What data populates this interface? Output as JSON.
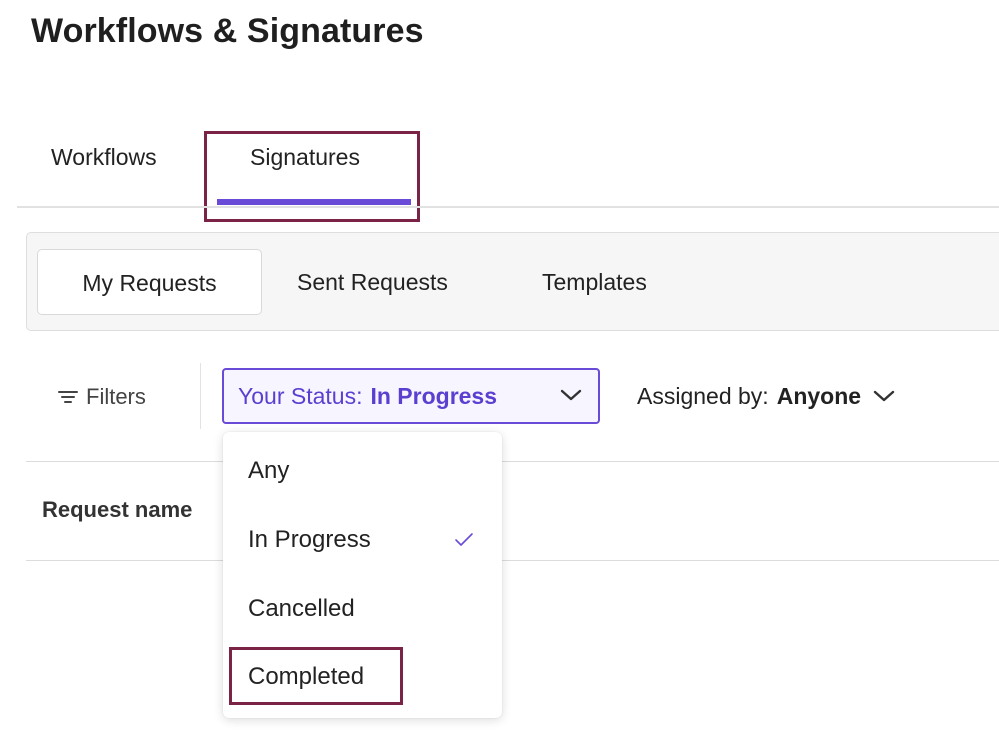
{
  "page_title": "Workflows & Signatures",
  "tabs": [
    {
      "label": "Workflows",
      "active": false
    },
    {
      "label": "Signatures",
      "active": true
    }
  ],
  "subtabs": [
    {
      "label": "My Requests",
      "active": true
    },
    {
      "label": "Sent Requests",
      "active": false
    },
    {
      "label": "Templates",
      "active": false
    }
  ],
  "filters": {
    "label": "Filters",
    "icon": "filter-lines-icon",
    "status": {
      "label": "Your Status:",
      "value": "In Progress",
      "icon": "chevron-down-icon"
    },
    "assigned": {
      "label": "Assigned by:",
      "value": "Anyone",
      "icon": "chevron-down-icon"
    }
  },
  "table": {
    "column_header": "Request name"
  },
  "status_dropdown": {
    "options": [
      {
        "label": "Any",
        "selected": false
      },
      {
        "label": "In Progress",
        "selected": true
      },
      {
        "label": "Cancelled",
        "selected": false
      },
      {
        "label": "Completed",
        "selected": false
      }
    ],
    "check_icon": "check-icon"
  },
  "colors": {
    "accent": "#6a4bd8",
    "highlight_border": "#7b2346",
    "status_bg": "#f7f5ff"
  }
}
